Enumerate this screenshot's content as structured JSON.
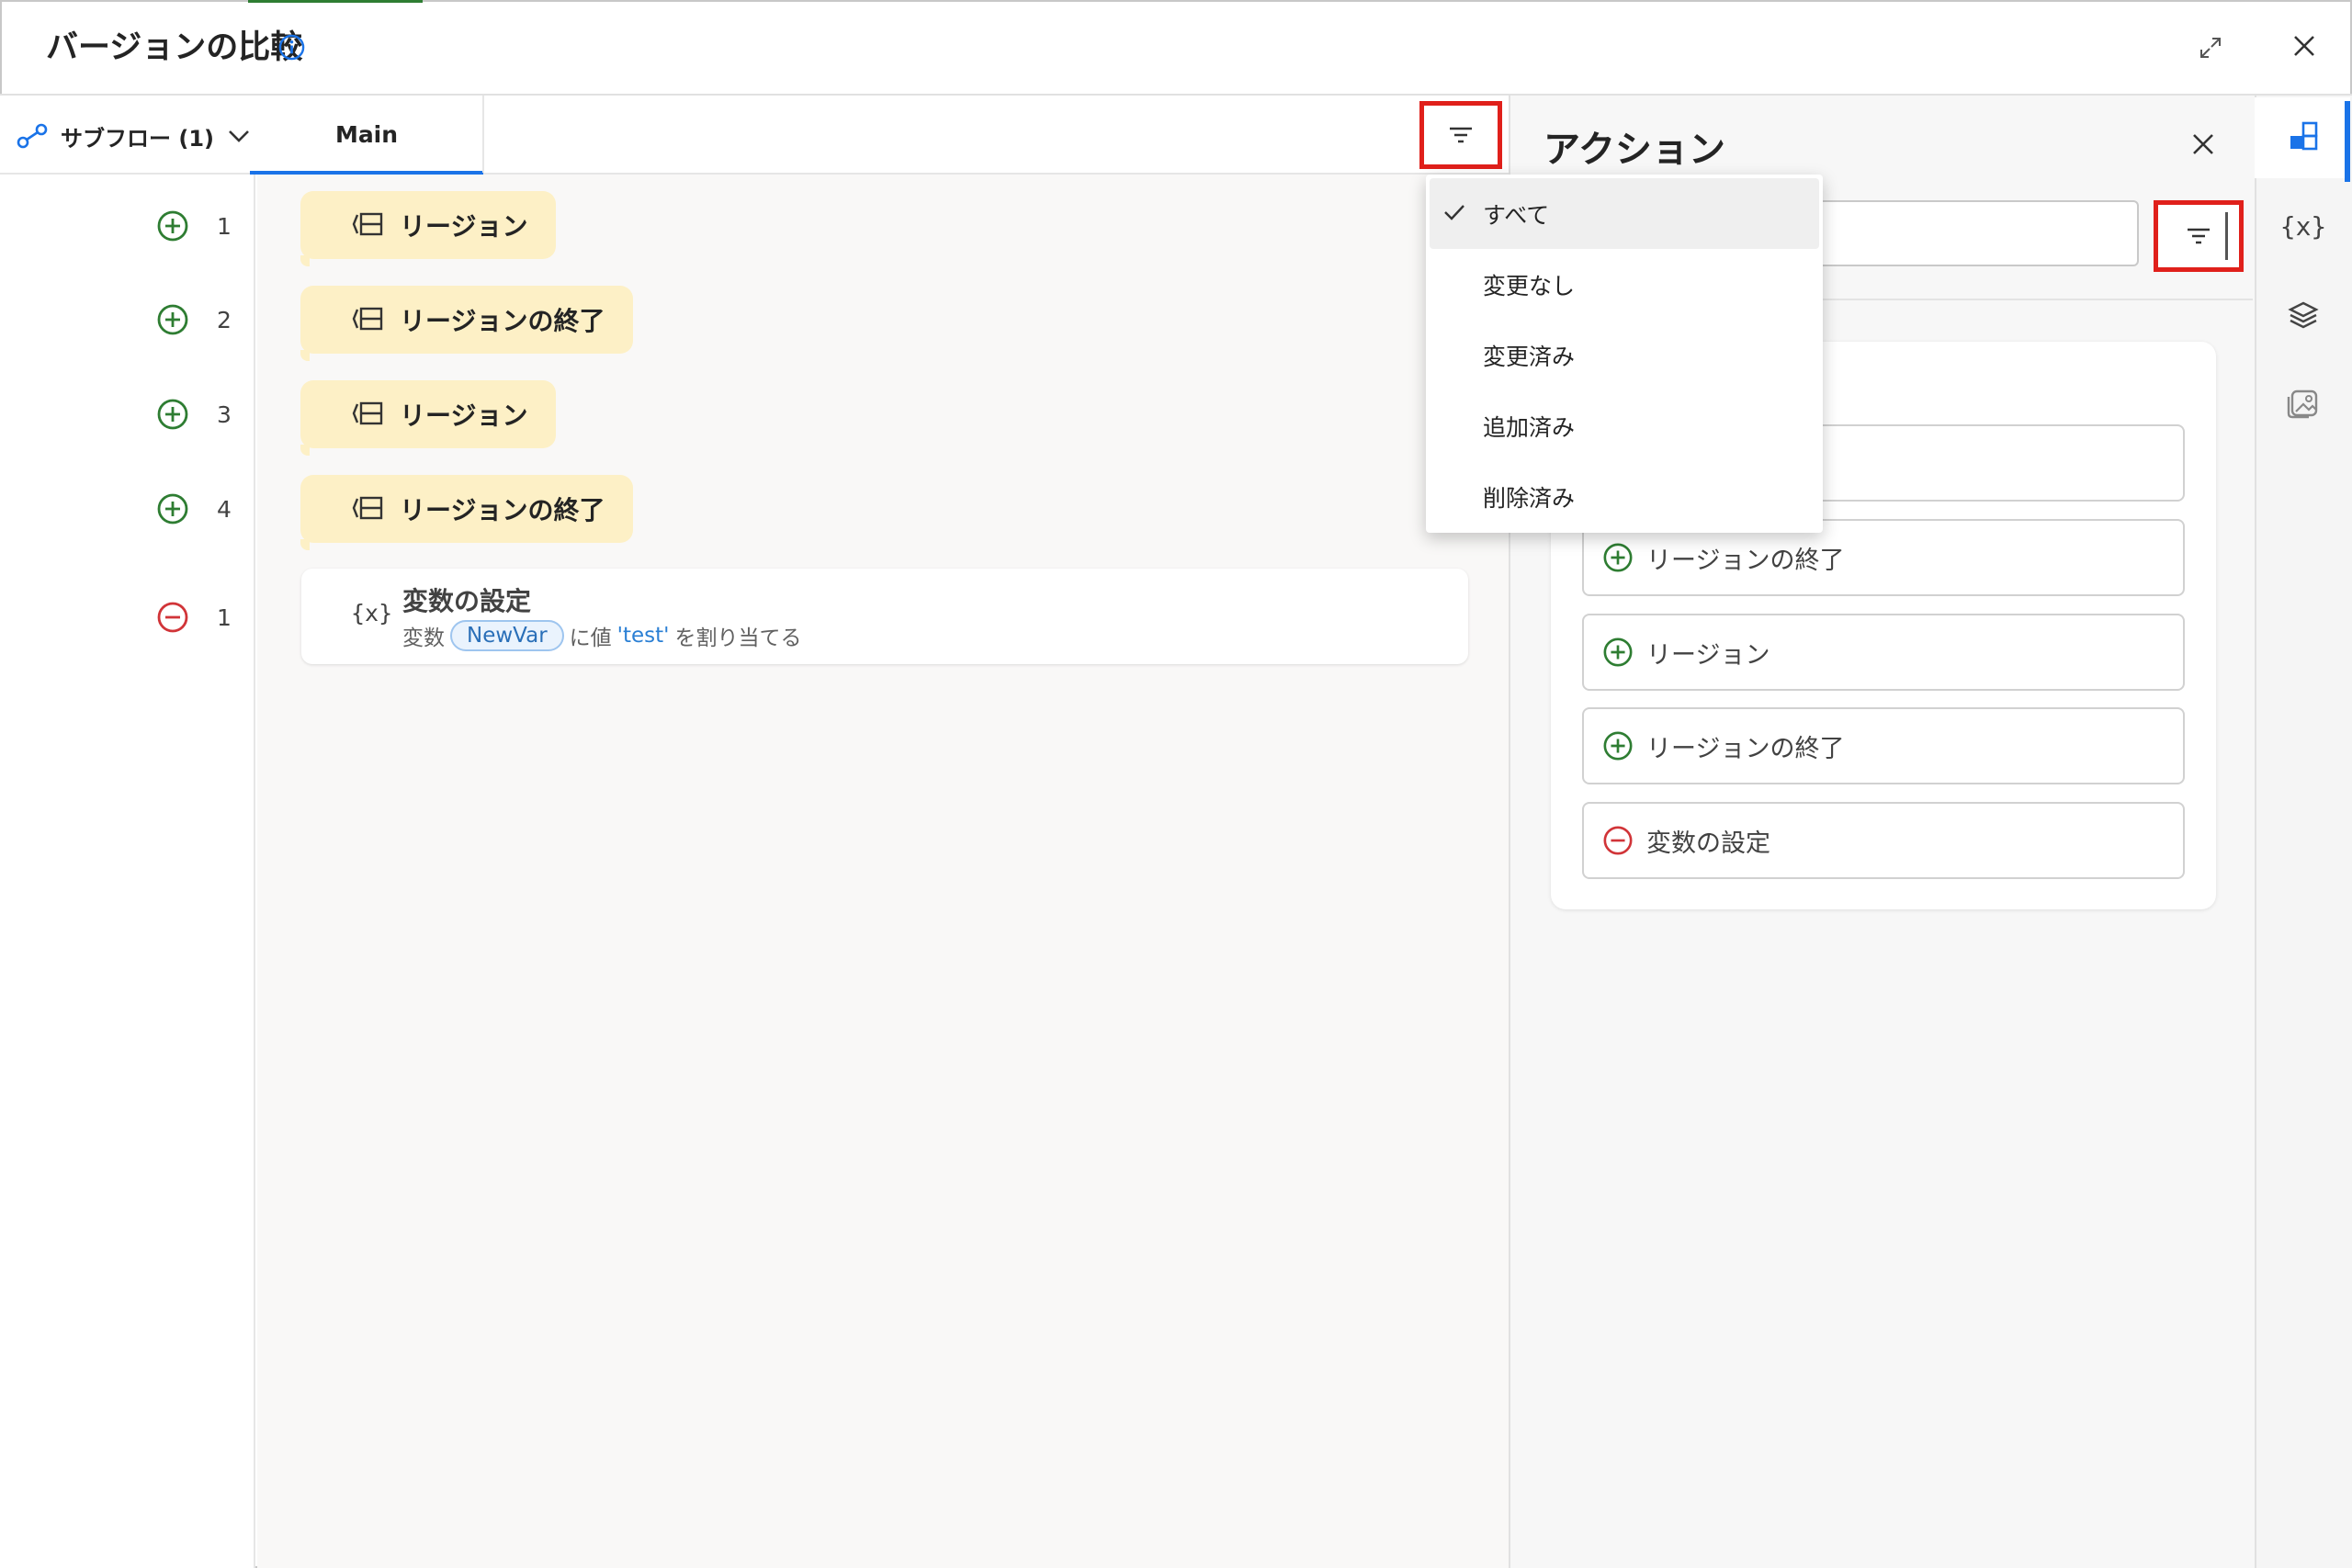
{
  "window": {
    "title": "バージョンの比較",
    "icons": [
      "info-icon",
      "expand-icon",
      "close-icon"
    ]
  },
  "toolbar": {
    "subflow_label": "サブフロー (1)",
    "tab_main": "Main"
  },
  "gutter": [
    {
      "status": "added",
      "number": "1"
    },
    {
      "status": "added",
      "number": "2"
    },
    {
      "status": "added",
      "number": "3"
    },
    {
      "status": "added",
      "number": "4"
    },
    {
      "status": "removed",
      "number": "1"
    }
  ],
  "flow": {
    "blocks": [
      {
        "label": "リージョン"
      },
      {
        "label": "リージョンの終了"
      },
      {
        "label": "リージョン"
      },
      {
        "label": "リージョンの終了"
      }
    ],
    "set_variable": {
      "icon_text": "{x}",
      "title": "変数の設定",
      "desc_prefix": "変数",
      "var_name": "NewVar",
      "desc_mid": "に値",
      "value": "'test'",
      "desc_suffix": "を割り当てる"
    }
  },
  "filter_menu": {
    "items": [
      "すべて",
      "変更なし",
      "変更済み",
      "追加済み",
      "削除済み"
    ],
    "selected": "すべて"
  },
  "actions_panel": {
    "title": "アクション",
    "search_value": "",
    "items": [
      {
        "status": "added",
        "label": ""
      },
      {
        "status": "added",
        "label": "リージョンの終了"
      },
      {
        "status": "added",
        "label": "リージョン"
      },
      {
        "status": "added",
        "label": "リージョンの終了"
      },
      {
        "status": "removed",
        "label": "変数の設定"
      }
    ]
  },
  "rail": {
    "var_icon_text": "{x}",
    "icons": [
      "actions-icon",
      "variables-icon",
      "layers-icon",
      "images-icon"
    ]
  },
  "colors": {
    "added": "#2e7d32",
    "removed": "#d13438",
    "accent": "#1a73e8",
    "highlight_box": "#e0201b",
    "region_bg": "#fdf0c6"
  }
}
